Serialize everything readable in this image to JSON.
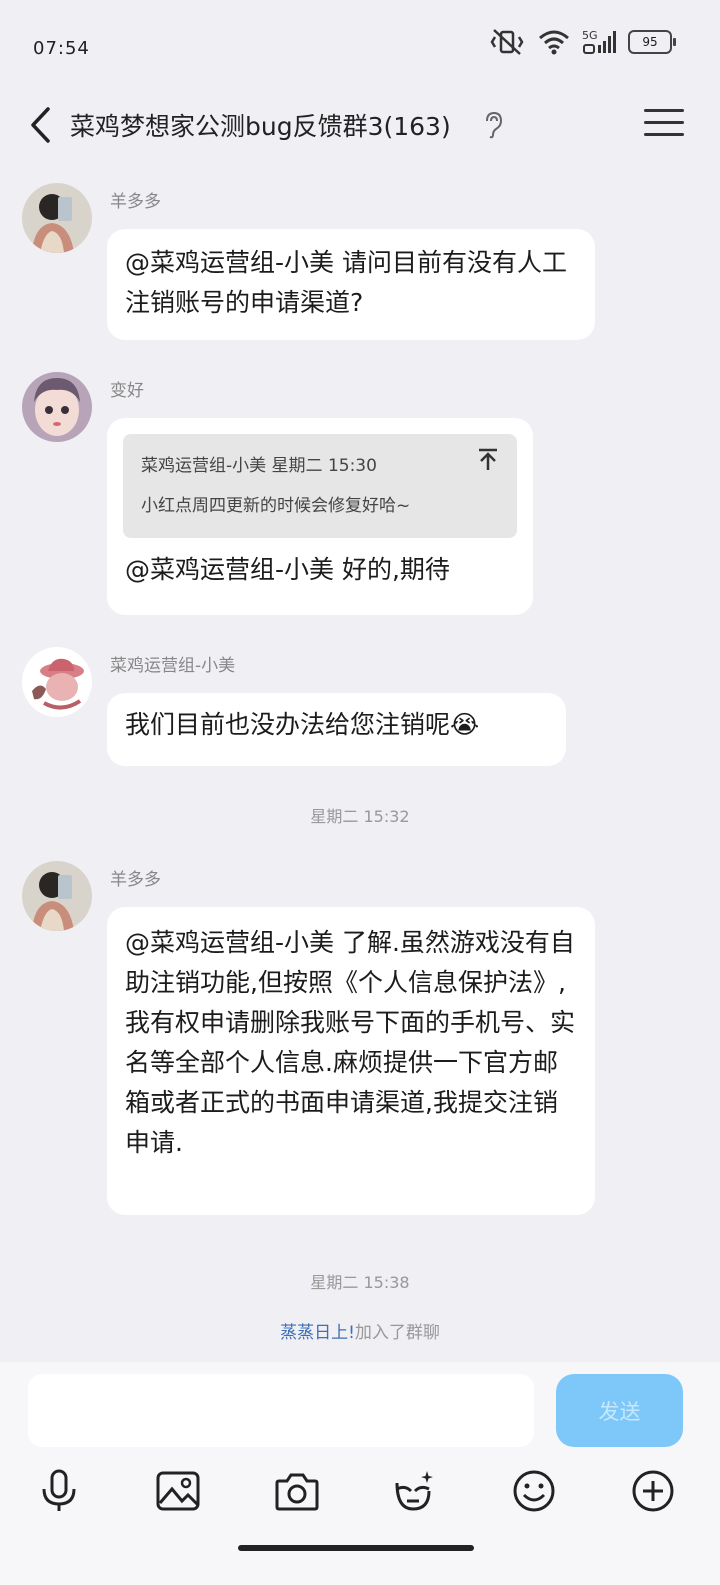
{
  "status": {
    "time": "07:54",
    "battery": "95",
    "network": "5G"
  },
  "header": {
    "title": "菜鸡梦想家公测bug反馈群3(163)"
  },
  "messages": [
    {
      "sender": "羊多多",
      "text": "@菜鸡运营组-小美 请问目前有没有人工注销账号的申请渠道?"
    },
    {
      "sender": "变好",
      "quote_header": "菜鸡运营组-小美 星期二 15:30",
      "quote_text": "小红点周四更新的时候会修复好哈~",
      "text": "@菜鸡运营组-小美 好的,期待"
    },
    {
      "sender": "菜鸡运营组-小美",
      "text": "我们目前也没办法给您注销呢😭"
    },
    {
      "sender": "羊多多",
      "text": "@菜鸡运营组-小美 了解.虽然游戏没有自助注销功能,但按照《个人信息保护法》,我有权申请删除我账号下面的手机号、实名等全部个人信息.麻烦提供一下官方邮箱或者正式的书面申请渠道,我提交注销申请."
    }
  ],
  "timestamps": [
    "星期二 15:32",
    "星期二 15:38"
  ],
  "system_message": {
    "name": "蒸蒸日上!",
    "action": "加入了群聊"
  },
  "input": {
    "send_label": "发送"
  },
  "colors": {
    "background": "#EFEFF4",
    "bubble": "#FFFFFF",
    "send_button": "#7EC8F9",
    "system_name": "#3D6FB6"
  },
  "toolbar": [
    "microphone-icon",
    "image-icon",
    "camera-icon",
    "face-effect-icon",
    "emoji-icon",
    "plus-icon"
  ]
}
